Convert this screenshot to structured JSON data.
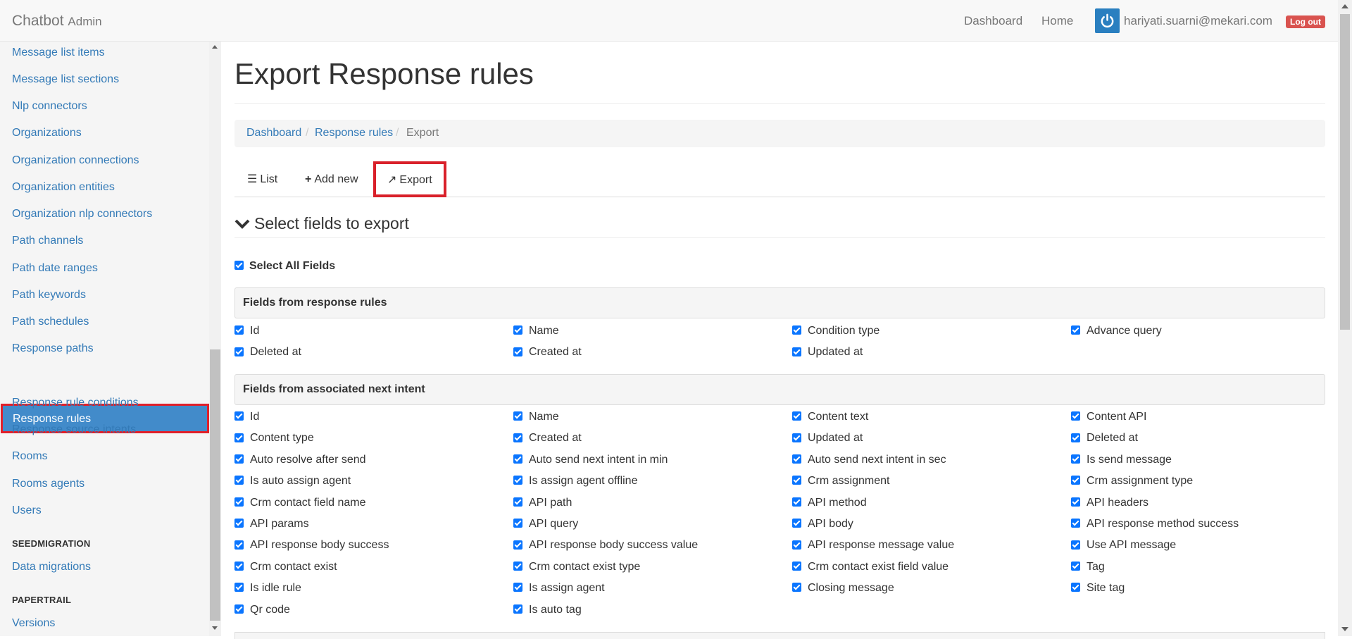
{
  "navbar": {
    "brand": "Chatbot",
    "brand_sub": "Admin",
    "links": [
      "Dashboard",
      "Home"
    ],
    "user_email": "hariyati.suarni@mekari.com",
    "logout": "Log out"
  },
  "sidebar": {
    "items": [
      "Message list items",
      "Message list sections",
      "Nlp connectors",
      "Organizations",
      "Organization connections",
      "Organization entities",
      "Organization nlp connectors",
      "Path channels",
      "Path date ranges",
      "Path keywords",
      "Path schedules",
      "Response paths",
      "Response rules",
      "Response rule conditions",
      "Response source intents",
      "Rooms",
      "Rooms agents",
      "Users"
    ],
    "active": "Response rules",
    "sections": [
      {
        "title": "SEEDMIGRATION",
        "items": [
          "Data migrations"
        ]
      },
      {
        "title": "PAPERTRAIL",
        "items": [
          "Versions"
        ]
      }
    ]
  },
  "page": {
    "title": "Export Response rules",
    "breadcrumb": [
      "Dashboard",
      "Response rules",
      "Export"
    ],
    "tabs": [
      "List",
      "Add new",
      "Export"
    ],
    "section_title": "Select fields to export",
    "select_all": "Select All Fields"
  },
  "groups": [
    {
      "title": "Fields from response rules",
      "fields": [
        "Id",
        "Name",
        "Condition type",
        "Advance query",
        "Deleted at",
        "Created at",
        "Updated at"
      ]
    },
    {
      "title": "Fields from associated next intent",
      "fields": [
        "Id",
        "Name",
        "Content text",
        "Content API",
        "Content type",
        "Created at",
        "Updated at",
        "Deleted at",
        "Auto resolve after send",
        "Auto send next intent in min",
        "Auto send next intent in sec",
        "Is send message",
        "Is auto assign agent",
        "Is assign agent offline",
        "Crm assignment",
        "Crm assignment type",
        "Crm contact field name",
        "API path",
        "API method",
        "API headers",
        "API params",
        "API query",
        "API body",
        "API response method success",
        "API response body success",
        "API response body success value",
        "API response message value",
        "Use API message",
        "Crm contact exist",
        "Crm contact exist type",
        "Crm contact exist field value",
        "Tag",
        "Is idle rule",
        "Is assign agent",
        "Closing message",
        "Site tag",
        "Qr code",
        "Is auto tag"
      ]
    }
  ],
  "colors": {
    "link": "#337ab7",
    "active_bg": "#428bca",
    "highlight_border": "#e0202a",
    "checkbox": "#0a75ff",
    "logout": "#d9534f"
  }
}
